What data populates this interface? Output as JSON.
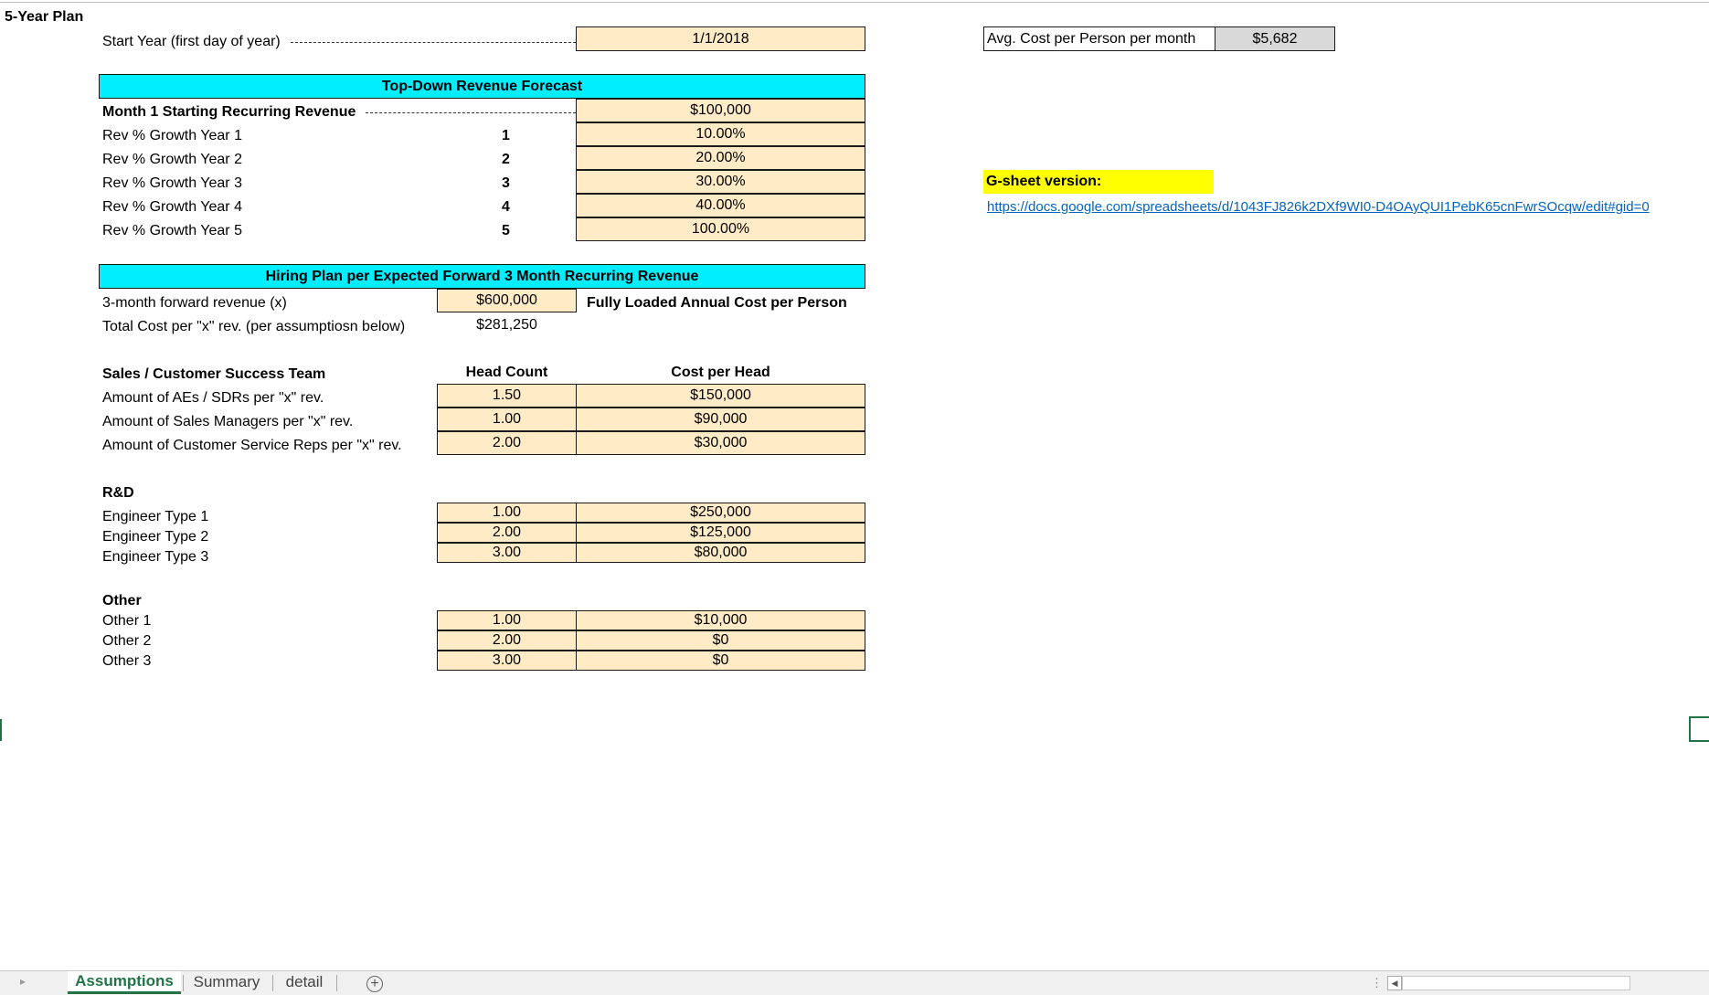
{
  "sheet_title": "5-Year Plan",
  "start_year": {
    "label": "Start Year (first day of year)",
    "value": "1/1/2018"
  },
  "avg_cost": {
    "label": "Avg. Cost per Person per month",
    "value": "$5,682"
  },
  "gsheet": {
    "label": "G-sheet version:",
    "url": "https://docs.google.com/spreadsheets/d/1043FJ826k2DXf9WI0-D4OAyQUI1PebK65cnFwrSOcqw/edit#gid=0"
  },
  "revenue_forecast": {
    "header": "Top-Down Revenue Forecast",
    "starting_label": "Month 1 Starting Recurring Revenue",
    "starting_value": "$100,000",
    "rows": [
      {
        "label": "Rev % Growth Year 1",
        "year": "1",
        "value": "10.00%"
      },
      {
        "label": "Rev % Growth Year 2",
        "year": "2",
        "value": "20.00%"
      },
      {
        "label": "Rev % Growth Year 3",
        "year": "3",
        "value": "30.00%"
      },
      {
        "label": "Rev % Growth Year 4",
        "year": "4",
        "value": "40.00%"
      },
      {
        "label": "Rev % Growth Year 5",
        "year": "5",
        "value": "100.00%"
      }
    ]
  },
  "hiring_plan": {
    "header": "Hiring Plan per Expected Forward 3 Month Recurring Revenue",
    "forward_label": "3-month forward revenue (x)",
    "forward_value": "$600,000",
    "fully_loaded_label": "Fully Loaded Annual Cost per Person",
    "total_cost_label": "Total Cost per \"x\" rev. (per assumptiosn below)",
    "total_cost_value": "$281,250"
  },
  "sales_team": {
    "title": "Sales / Customer Success Team",
    "col_headcount": "Head Count",
    "col_cost": "Cost per Head",
    "rows": [
      {
        "label": "Amount of AEs / SDRs per \"x\" rev.",
        "headcount": "1.50",
        "cost": "$150,000"
      },
      {
        "label": "Amount of Sales Managers per \"x\" rev.",
        "headcount": "1.00",
        "cost": "$90,000"
      },
      {
        "label": "Amount of Customer Service Reps per \"x\" rev.",
        "headcount": "2.00",
        "cost": "$30,000"
      }
    ]
  },
  "rnd": {
    "title": "R&D",
    "rows": [
      {
        "label": "Engineer Type 1",
        "headcount": "1.00",
        "cost": "$250,000"
      },
      {
        "label": "Engineer Type 2",
        "headcount": "2.00",
        "cost": "$125,000"
      },
      {
        "label": "Engineer Type 3",
        "headcount": "3.00",
        "cost": "$80,000"
      }
    ]
  },
  "other": {
    "title": "Other",
    "rows": [
      {
        "label": "Other 1",
        "headcount": "1.00",
        "cost": "$10,000"
      },
      {
        "label": "Other 2",
        "headcount": "2.00",
        "cost": "$0"
      },
      {
        "label": "Other 3",
        "headcount": "3.00",
        "cost": "$0"
      }
    ]
  },
  "tabs": [
    {
      "label": "Assumptions",
      "active": true
    },
    {
      "label": "Summary",
      "active": false
    },
    {
      "label": "detail",
      "active": false
    }
  ],
  "add_sheet_icon": "plus-circle-icon"
}
